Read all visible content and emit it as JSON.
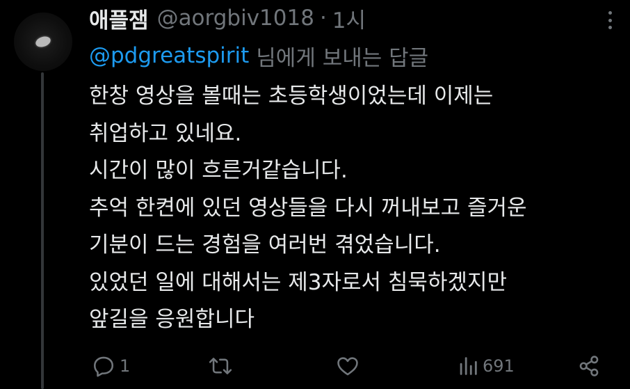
{
  "tweet": {
    "display_name": "애플잼",
    "handle": "@aorgbiv1018",
    "separator": "·",
    "time": "1시",
    "reply_to": {
      "mention": "@pdgreatspirit",
      "suffix": "님에게 보내는 답글"
    },
    "body_lines": [
      "한창 영상을 볼때는 초등학생이었는데 이제는",
      "취업하고 있네요.",
      "시간이 많이 흐른거같습니다.",
      "추억 한켠에 있던 영상들을 다시 꺼내보고 즐거운",
      "기분이 드는 경험을 여러번 겪었습니다.",
      "있었던 일에 대해서는 제3자로서 침묵하겠지만",
      "앞길을 응원합니다"
    ]
  },
  "actions": {
    "reply_count": "1",
    "retweet_count": "",
    "like_count": "",
    "views_count": "691"
  },
  "icons": {
    "reply": "reply-icon",
    "retweet": "retweet-icon",
    "like": "heart-icon",
    "views": "views-icon",
    "share": "share-icon",
    "more": "more-icon"
  },
  "colors": {
    "background": "#000000",
    "text": "#e7e9ea",
    "secondary": "#71767b",
    "link": "#1d9bf0"
  }
}
